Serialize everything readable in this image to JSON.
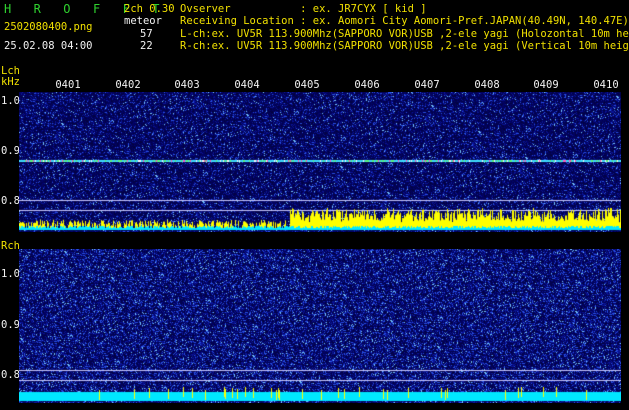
{
  "app": {
    "title": "H R O F F T",
    "version": "2ch 0.30"
  },
  "file": {
    "name": "2502080400.png",
    "datetime": "25.02.08 04:00"
  },
  "meteor": {
    "label": "meteor",
    "lch_count": "57",
    "rch_count": "22"
  },
  "info": {
    "observer": "Ovserver           : ex. JR7CYX [ kid ]",
    "location": "Receiving Location : ex. Aomori City Aomori-Pref.JAPAN(40.49N, 140.47E)",
    "lch": "L-ch:ex. UV5R 113.900Mhz(SAPPORO VOR)USB ,2-ele yagi (Holozontal 10m height)",
    "rch": "R-ch:ex. UV5R 113.900Mhz(SAPPORO VOR)USB ,2-ele yagi (Vertical 10m height)"
  },
  "time_ticks": [
    "0401",
    "0402",
    "0403",
    "0404",
    "0405",
    "0406",
    "0407",
    "0408",
    "0409",
    "0410"
  ],
  "lch": {
    "label": "Lch",
    "unit": "kHz",
    "y_labels": [
      "1.0",
      "0.9",
      "0.8"
    ]
  },
  "rch": {
    "label": "Rch",
    "y_labels": [
      "1.0",
      "0.9",
      "0.8"
    ]
  },
  "colors": {
    "background": "#000000",
    "title_green": "#2fd22f",
    "label_yellow": "#f0e000",
    "text_white": "#f2f2f2",
    "noise_dark": "#06066a",
    "signal_line": "#40e0ff",
    "level_cyan": "#00e8ff",
    "level_yellow": "#ffff00"
  }
}
